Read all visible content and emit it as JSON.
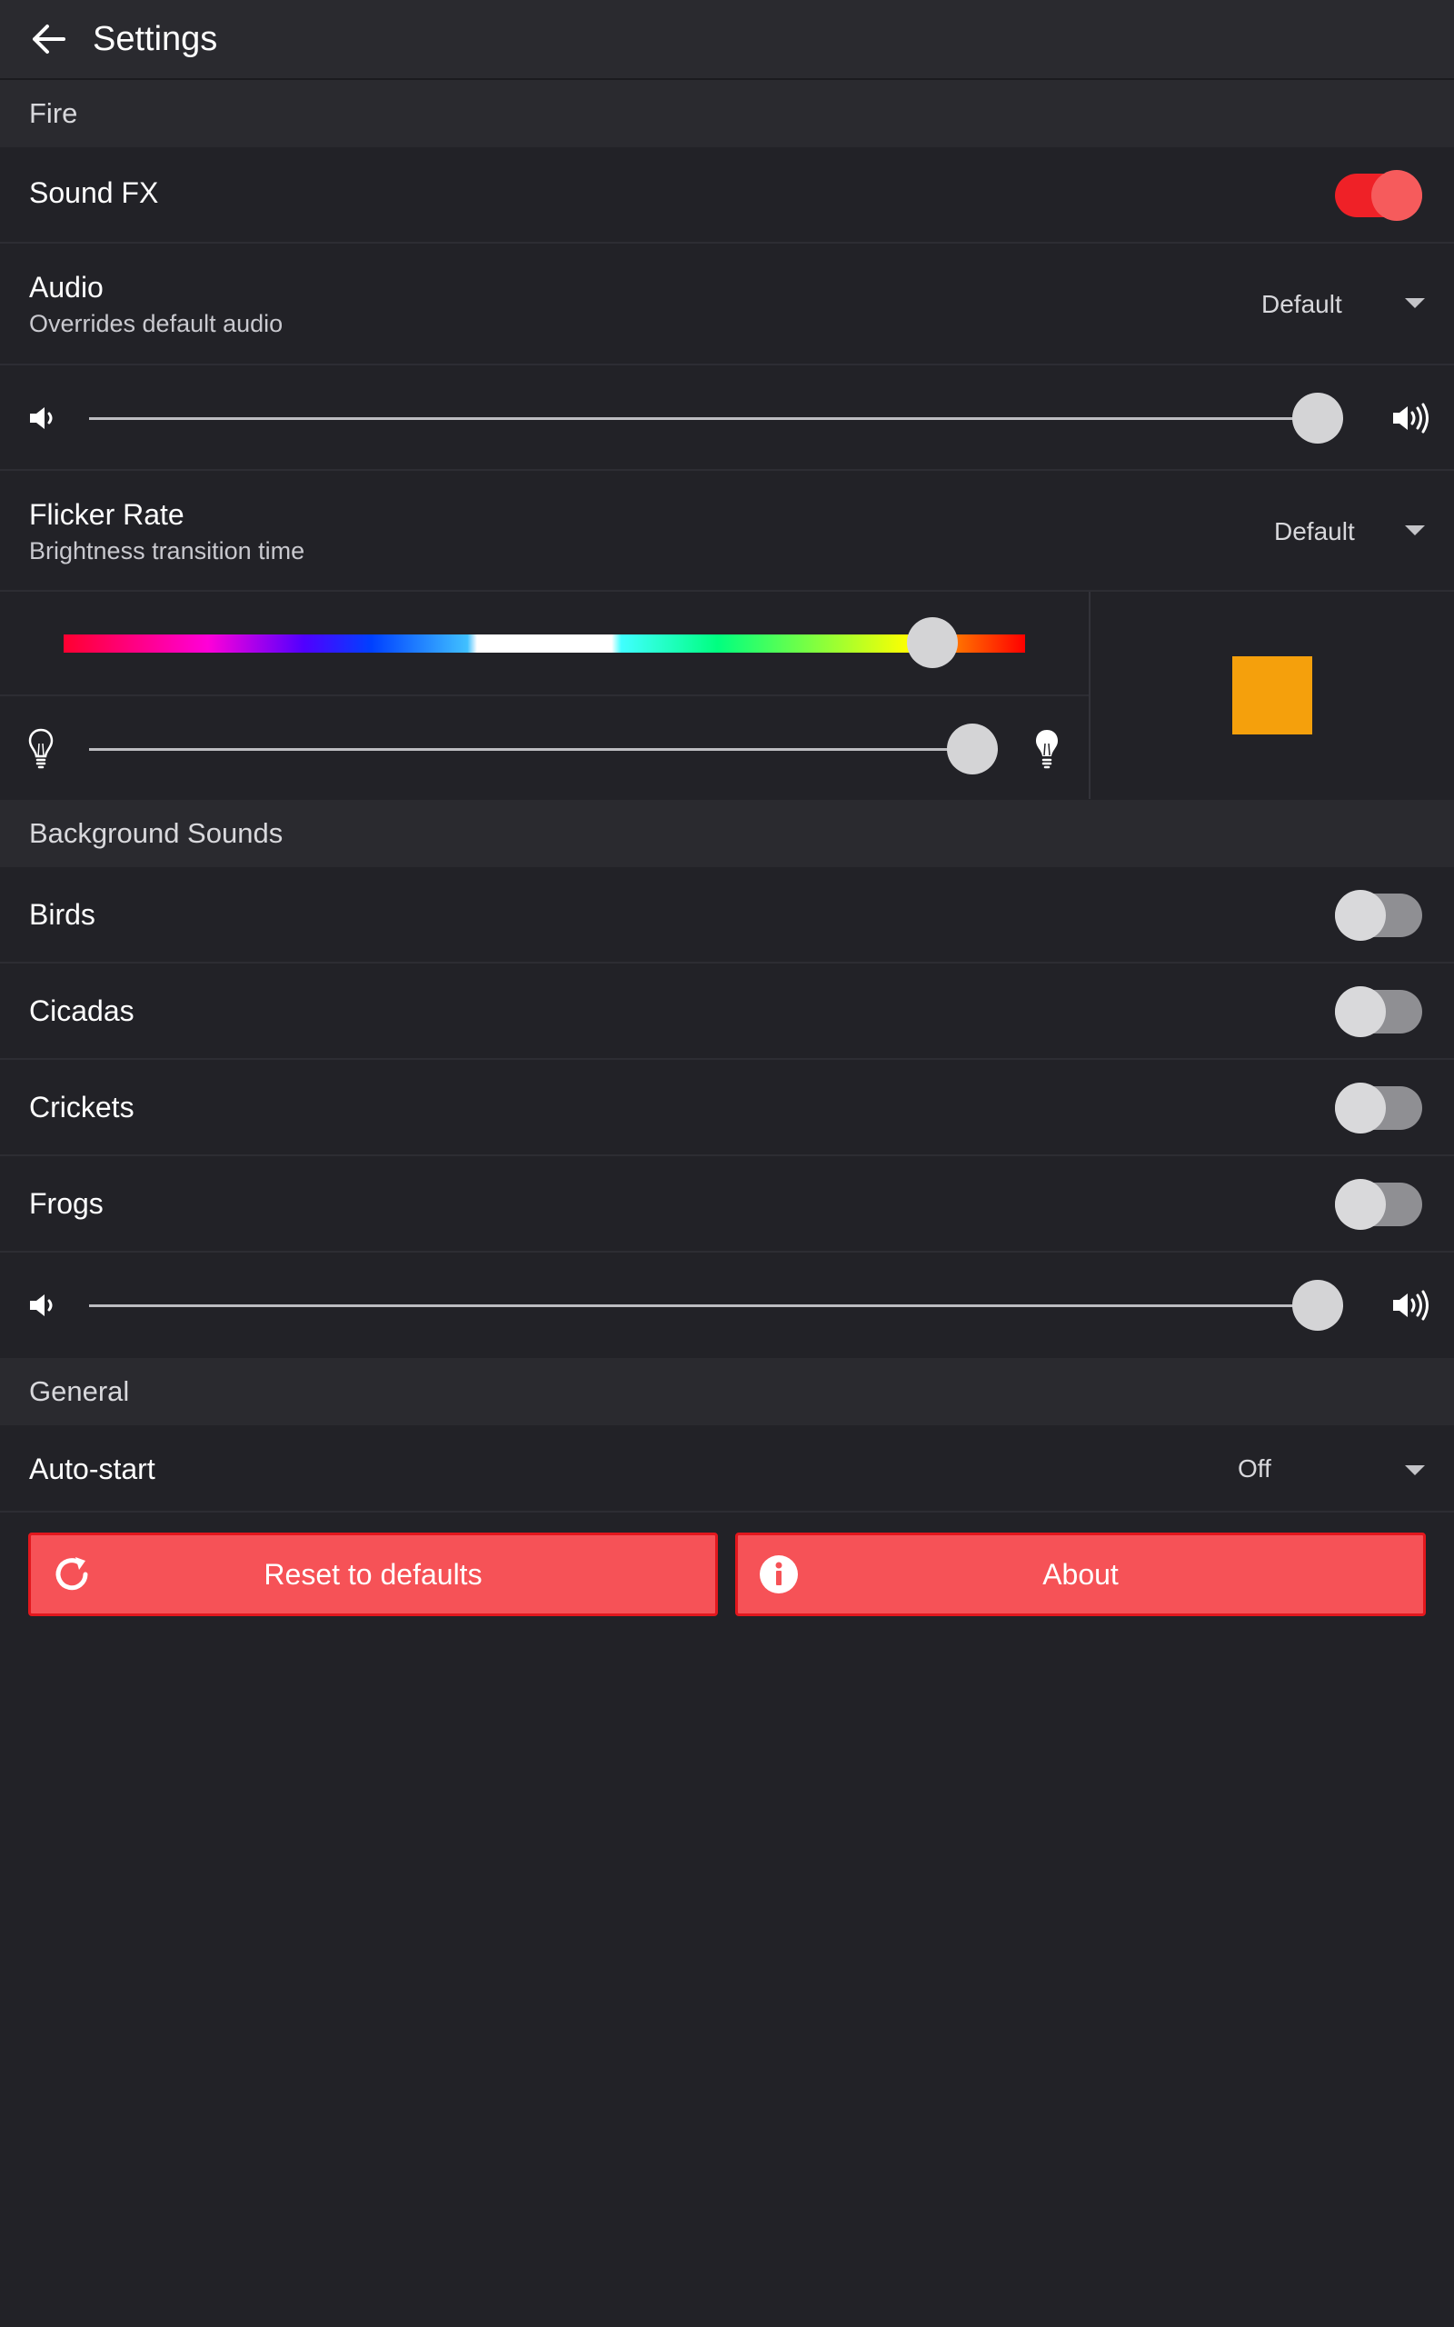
{
  "header": {
    "title": "Settings",
    "back_icon": "arrow-left-icon"
  },
  "sections": {
    "fire": {
      "title": "Fire",
      "sound_fx": {
        "label": "Sound FX",
        "enabled": true
      },
      "audio": {
        "label": "Audio",
        "subtitle": "Overrides default audio",
        "value": "Default"
      },
      "volume": {
        "level": 1.0,
        "icon_low": "volume-low-icon",
        "icon_high": "volume-high-icon"
      },
      "flicker_rate": {
        "label": "Flicker Rate",
        "subtitle": "Brightness transition time",
        "value": "Default"
      },
      "color": {
        "hue_position": 0.9,
        "swatch_color": "#f5a00c"
      },
      "brightness": {
        "level": 1.0,
        "icon_low": "bulb-outline-icon",
        "icon_high": "bulb-filled-icon"
      }
    },
    "background_sounds": {
      "title": "Background Sounds",
      "items": [
        {
          "label": "Birds",
          "enabled": false
        },
        {
          "label": "Cicadas",
          "enabled": false
        },
        {
          "label": "Crickets",
          "enabled": false
        },
        {
          "label": "Frogs",
          "enabled": false
        }
      ],
      "volume": {
        "level": 1.0,
        "icon_low": "volume-low-icon",
        "icon_high": "volume-high-icon"
      }
    },
    "general": {
      "title": "General",
      "auto_start": {
        "label": "Auto-start",
        "value": "Off"
      }
    }
  },
  "buttons": {
    "reset": {
      "label": "Reset to defaults",
      "icon": "refresh-icon"
    },
    "about": {
      "label": "About",
      "icon": "info-icon"
    }
  },
  "colors": {
    "accent": "#f65257",
    "toggle_on": "#ef2127",
    "background": "#222227",
    "header": "#2a2a2f"
  }
}
